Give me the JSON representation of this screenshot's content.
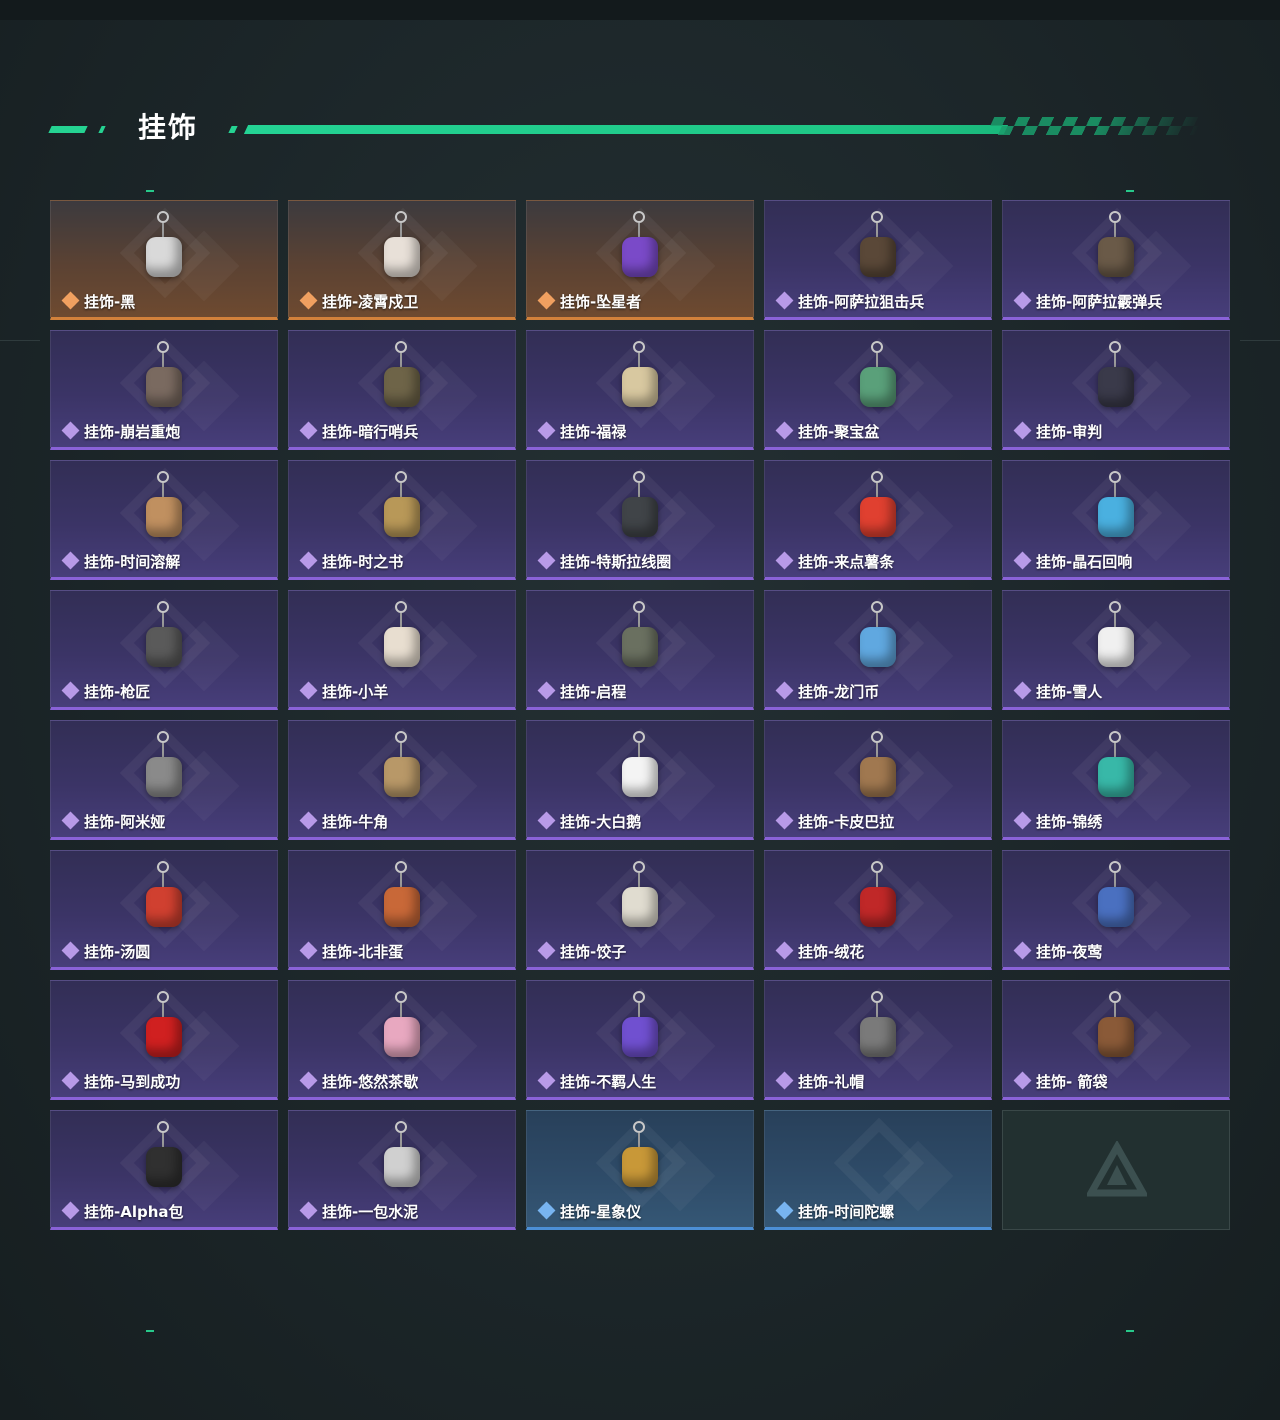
{
  "header": {
    "title": "挂饰"
  },
  "colors": {
    "accent": "#25d392",
    "purple_rarity": "#8a62d8",
    "orange_rarity": "#d2813b",
    "blue_rarity": "#4c8fd6"
  },
  "items": [
    {
      "label": "挂饰-黑",
      "rarity": "orange",
      "icon": "card-charm-icon",
      "color": "#d9d9d9"
    },
    {
      "label": "挂饰-凌霄戍卫",
      "rarity": "orange",
      "icon": "bird-charm-icon",
      "color": "#e8e0d8"
    },
    {
      "label": "挂饰-坠星者",
      "rarity": "orange",
      "icon": "crystal-charm-icon",
      "color": "#7a4ac8"
    },
    {
      "label": "挂饰-阿萨拉狙击兵",
      "rarity": "purple",
      "icon": "soldier-charm-icon",
      "color": "#5a4838"
    },
    {
      "label": "挂饰-阿萨拉霰弹兵",
      "rarity": "purple",
      "icon": "soldier-charm-icon",
      "color": "#6a5a48"
    },
    {
      "label": "挂饰-崩岩重炮",
      "rarity": "purple",
      "icon": "soldier-charm-icon",
      "color": "#7a6a60"
    },
    {
      "label": "挂饰-暗行哨兵",
      "rarity": "purple",
      "icon": "soldier-charm-icon",
      "color": "#6e6448"
    },
    {
      "label": "挂饰-福禄",
      "rarity": "purple",
      "icon": "gourd-charm-icon",
      "color": "#d8c8a0"
    },
    {
      "label": "挂饰-聚宝盆",
      "rarity": "purple",
      "icon": "bowl-charm-icon",
      "color": "#5aa07a"
    },
    {
      "label": "挂饰-审判",
      "rarity": "purple",
      "icon": "tag-charm-icon",
      "color": "#3a3a4a"
    },
    {
      "label": "挂饰-时间溶解",
      "rarity": "purple",
      "icon": "clock-charm-icon",
      "color": "#c09060"
    },
    {
      "label": "挂饰-时之书",
      "rarity": "purple",
      "icon": "book-charm-icon",
      "color": "#b89858"
    },
    {
      "label": "挂饰-特斯拉线圈",
      "rarity": "purple",
      "icon": "coil-charm-icon",
      "color": "#404448"
    },
    {
      "label": "挂饰-来点薯条",
      "rarity": "purple",
      "icon": "fries-charm-icon",
      "color": "#e04030"
    },
    {
      "label": "挂饰-晶石回响",
      "rarity": "purple",
      "icon": "crystal-charm-icon",
      "color": "#4ab0e0"
    },
    {
      "label": "挂饰-枪匠",
      "rarity": "purple",
      "icon": "plate-charm-icon",
      "color": "#5a5a5a"
    },
    {
      "label": "挂饰-小羊",
      "rarity": "purple",
      "icon": "sheep-charm-icon",
      "color": "#e8ded0"
    },
    {
      "label": "挂饰-启程",
      "rarity": "purple",
      "icon": "medal-charm-icon",
      "color": "#6a7060"
    },
    {
      "label": "挂饰-龙门币",
      "rarity": "purple",
      "icon": "coin-charm-icon",
      "color": "#60a8e0"
    },
    {
      "label": "挂饰-雪人",
      "rarity": "purple",
      "icon": "snowman-charm-icon",
      "color": "#f0f0f0"
    },
    {
      "label": "挂饰-阿米娅",
      "rarity": "purple",
      "icon": "rabbit-charm-icon",
      "color": "#8a8a8a"
    },
    {
      "label": "挂饰-牛角",
      "rarity": "purple",
      "icon": "horn-charm-icon",
      "color": "#b89868"
    },
    {
      "label": "挂饰-大白鹅",
      "rarity": "purple",
      "icon": "goose-charm-icon",
      "color": "#f4f4f4"
    },
    {
      "label": "挂饰-卡皮巴拉",
      "rarity": "purple",
      "icon": "capybara-charm-icon",
      "color": "#a07850"
    },
    {
      "label": "挂饰-锦绣",
      "rarity": "purple",
      "icon": "butterfly-charm-icon",
      "color": "#38b8a8"
    },
    {
      "label": "挂饰-汤圆",
      "rarity": "purple",
      "icon": "bowl-charm-icon",
      "color": "#d04030"
    },
    {
      "label": "挂饰-北非蛋",
      "rarity": "purple",
      "icon": "pan-charm-icon",
      "color": "#c86838"
    },
    {
      "label": "挂饰-饺子",
      "rarity": "purple",
      "icon": "plate-charm-icon",
      "color": "#e0dcd0"
    },
    {
      "label": "挂饰-绒花",
      "rarity": "purple",
      "icon": "flower-charm-icon",
      "color": "#c02828"
    },
    {
      "label": "挂饰-夜莺",
      "rarity": "purple",
      "icon": "feather-charm-icon",
      "color": "#4a70c0"
    },
    {
      "label": "挂饰-马到成功",
      "rarity": "purple",
      "icon": "horse-charm-icon",
      "color": "#d02020"
    },
    {
      "label": "挂饰-悠然茶歇",
      "rarity": "purple",
      "icon": "cupcake-charm-icon",
      "color": "#e8a8c0"
    },
    {
      "label": "挂饰-不羁人生",
      "rarity": "purple",
      "icon": "sneaker-charm-icon",
      "color": "#7050d0"
    },
    {
      "label": "挂饰-礼帽",
      "rarity": "purple",
      "icon": "hat-charm-icon",
      "color": "#7a7a7a"
    },
    {
      "label": "挂饰- 箭袋",
      "rarity": "purple",
      "icon": "quiver-charm-icon",
      "color": "#8a5a38"
    },
    {
      "label": "挂饰-Alpha包",
      "rarity": "purple",
      "icon": "pouch-charm-icon",
      "color": "#303030"
    },
    {
      "label": "挂饰-一包水泥",
      "rarity": "purple",
      "icon": "bag-charm-icon",
      "color": "#d0d0d0"
    },
    {
      "label": "挂饰-星象仪",
      "rarity": "blue",
      "icon": "astrolabe-charm-icon",
      "color": "#c89838"
    },
    {
      "label": "挂饰-时间陀螺",
      "rarity": "blue",
      "icon": "",
      "color": ""
    },
    {
      "label": "",
      "rarity": "empty",
      "icon": "delta-logo-icon",
      "color": "#3c5050"
    }
  ]
}
